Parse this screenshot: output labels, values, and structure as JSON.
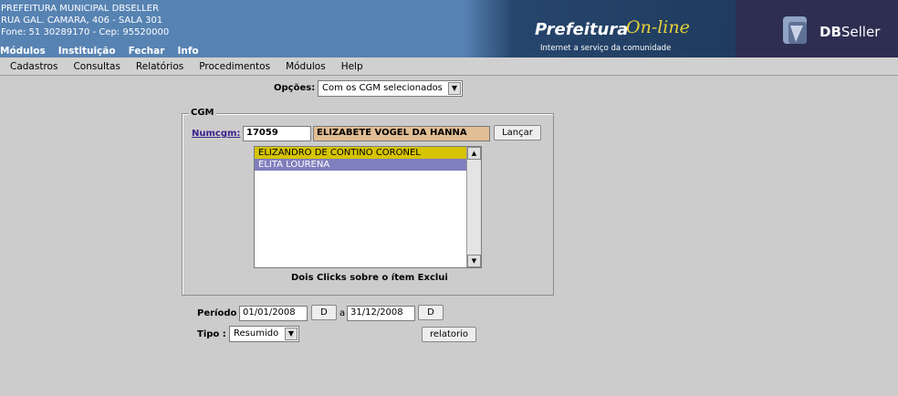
{
  "header": {
    "org_lines": [
      "PREFEITURA MUNICIPAL DBSELLER",
      "RUA GAL. CAMARA, 406 - SALA 301",
      "Fone: 51 30289170  -  Cep: 95520000"
    ],
    "top_menu": [
      "Módulos",
      "Instituição",
      "Fechar",
      "Info"
    ],
    "banner_word1": "Prefeitura",
    "banner_word2": "On-line",
    "banner_tagline": "Internet a serviço da comunidade",
    "brand_db": "DB",
    "brand_seller": "Seller"
  },
  "menubar": [
    "Cadastros",
    "Consultas",
    "Relatórios",
    "Procedimentos",
    "Módulos",
    "Help"
  ],
  "form": {
    "opcoes_label": "Opções:",
    "opcoes_value": "Com os CGM selecionados",
    "cgm_legend": "CGM",
    "numcgm_label": "Numcgm:",
    "numcgm_value": "17059",
    "nome_value": "ELIZABETE VOGEL DA HANNA",
    "lancar_label": "Lançar",
    "list_items": [
      "ELIZANDRO DE CONTINO CORONEL",
      "ELITA LOURENA"
    ],
    "list_hint": "Dois Clicks sobre o ítem Exclui",
    "periodo_label": "Período",
    "data_inicio": "01/01/2008",
    "d_button": "D",
    "a_label": "a",
    "data_fim": "31/12/2008",
    "tipo_label": "Tipo :",
    "tipo_value": "Resumido",
    "relatorio_label": "relatorio"
  },
  "colors": {
    "header_bg": "#5783b3",
    "list_item_1_bg": "#d6c400",
    "list_item_2_bg": "#7f7fbf",
    "nome_bg": "#e2be94",
    "link_color": "#3b238c"
  }
}
